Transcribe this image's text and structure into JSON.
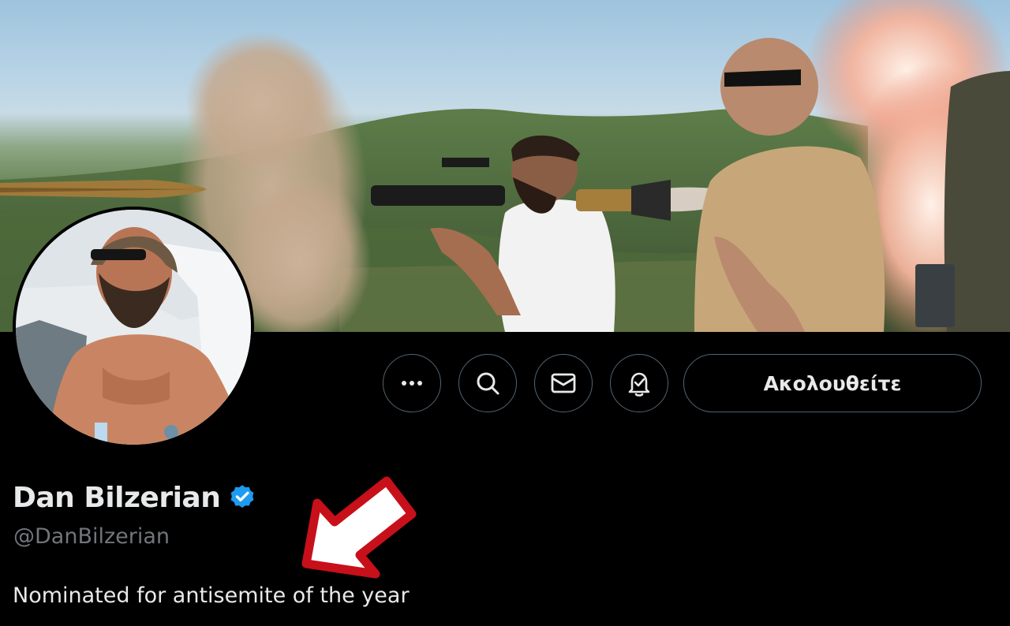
{
  "profile": {
    "display_name": "Dan Bilzerian",
    "verified": true,
    "handle": "@DanBilzerian",
    "bio": "Nominated for antisemite of the year"
  },
  "actions": {
    "more_icon": "more-horizontal-icon",
    "search_icon": "search-icon",
    "message_icon": "envelope-icon",
    "notify_icon": "bell-check-icon",
    "follow_label": "Ακολουθείτε"
  },
  "colors": {
    "background": "#000000",
    "primary_text": "#e7e9ea",
    "secondary_text": "#71767b",
    "button_border": "#536471",
    "verified_badge": "#1d9bf0",
    "annotation_arrow": "#c8101a"
  }
}
